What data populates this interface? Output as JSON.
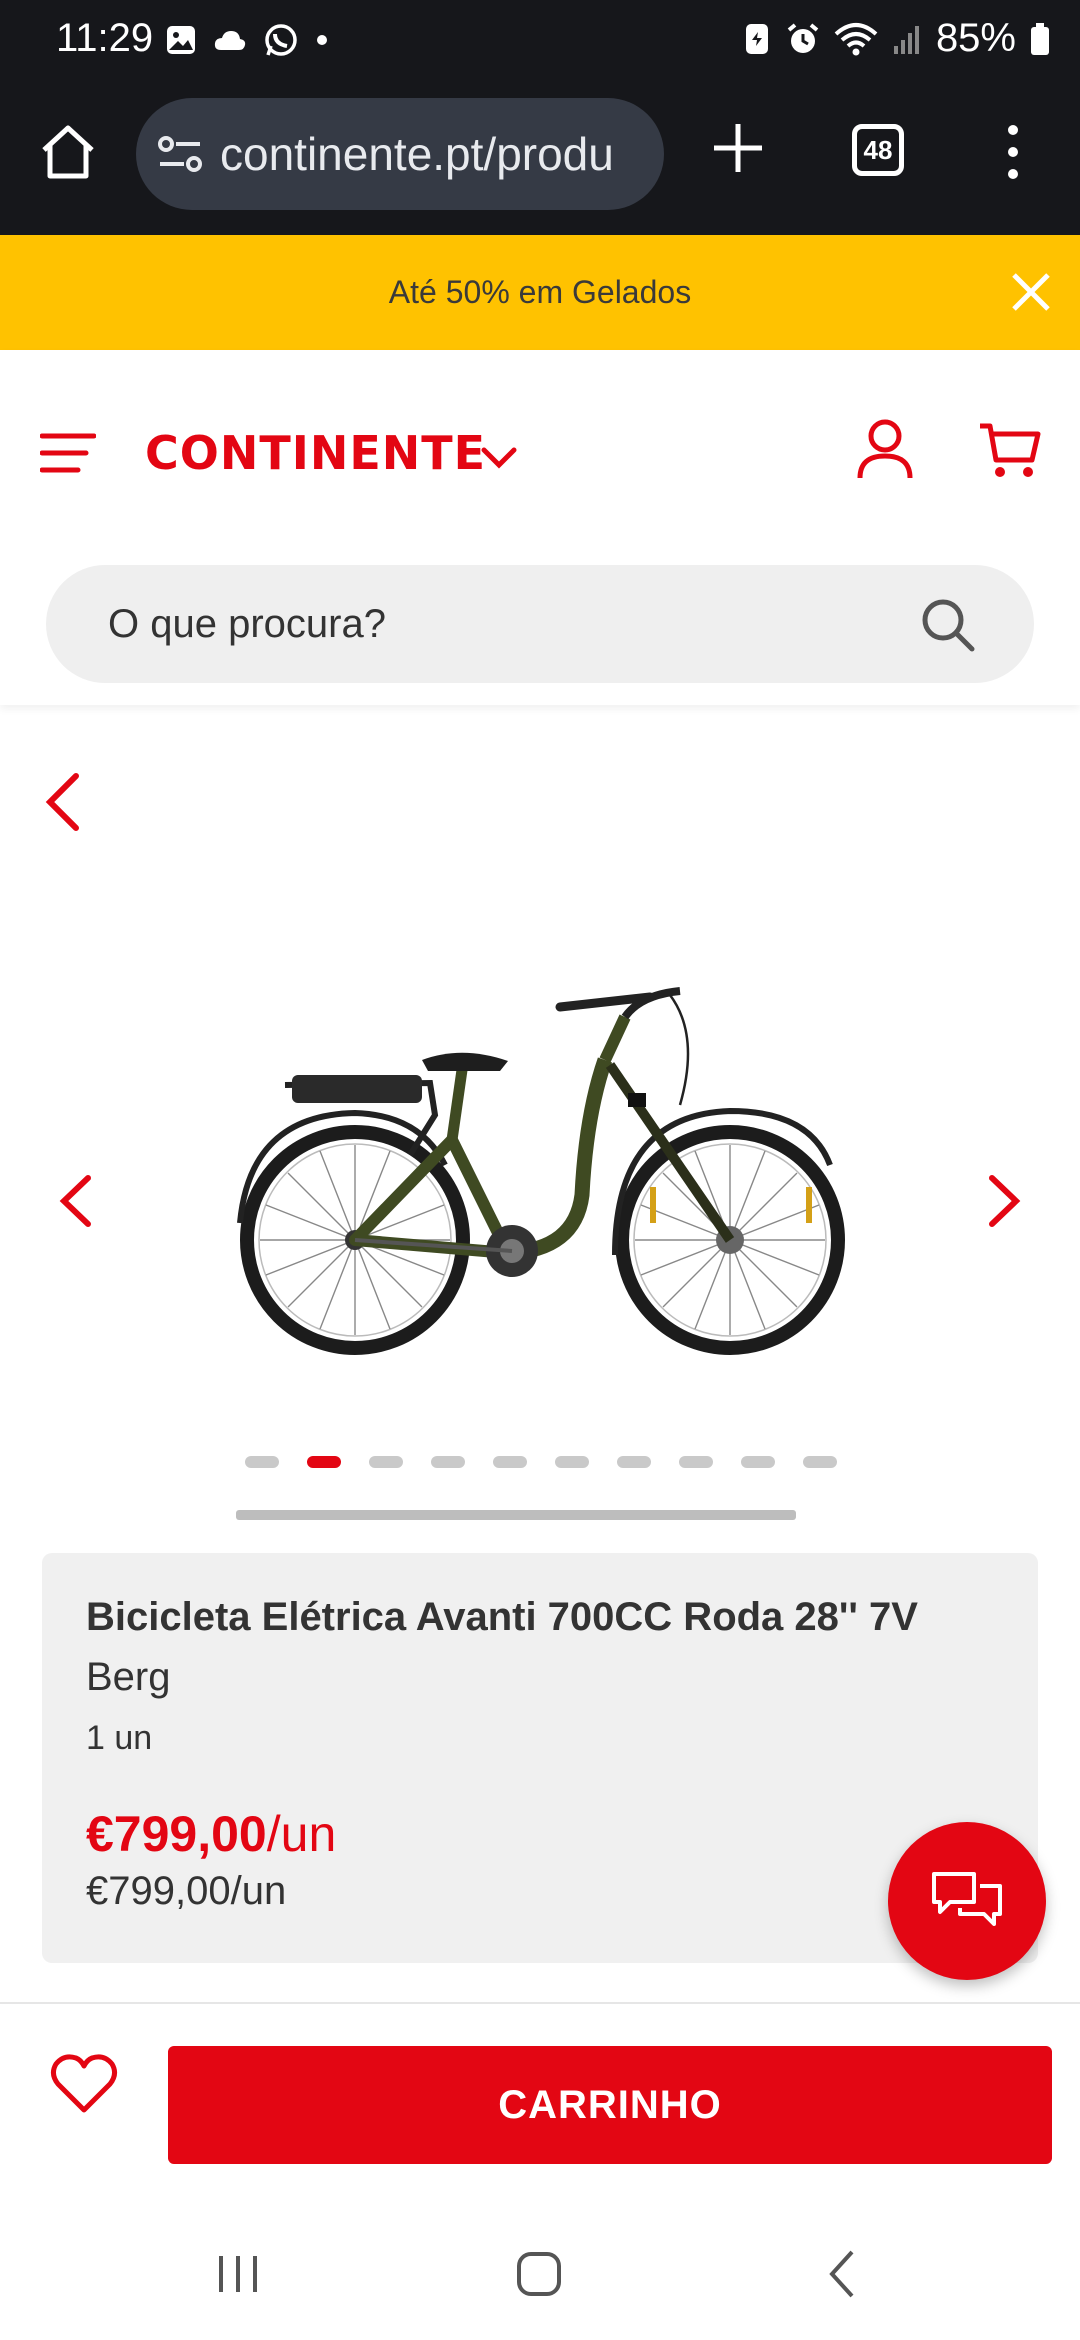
{
  "status_bar": {
    "time": "11:29",
    "battery": "85%"
  },
  "browser": {
    "url": "continente.pt/produ",
    "tab_count": "48"
  },
  "promo": {
    "text": "Até 50% em Gelados"
  },
  "header": {
    "brand": "CONTINENTE",
    "search_placeholder": "O que procura?"
  },
  "gallery": {
    "image_count": 10,
    "active_index": 1
  },
  "product": {
    "name": "Bicicleta Elétrica Avanti 700CC Roda 28'' 7V",
    "brand": "Berg",
    "quantity": "1 un",
    "price": "€799,00",
    "price_unit": "/un",
    "reference_price": "€799,00/un"
  },
  "actions": {
    "cart_label": "CARRINHO"
  },
  "colors": {
    "brand_red": "#e30613",
    "promo_yellow": "#ffc200",
    "browser_dark": "#16171b"
  }
}
